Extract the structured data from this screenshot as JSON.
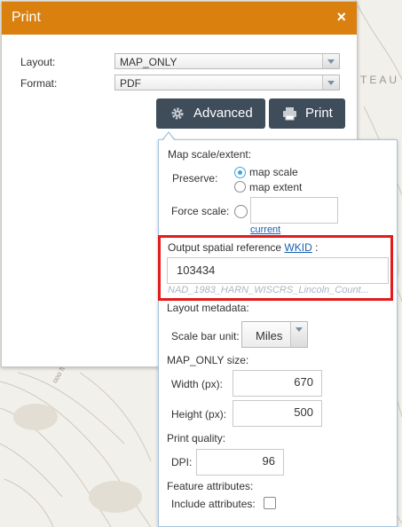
{
  "map": {
    "label_right": "TEAU",
    "label_small": "ooo ft"
  },
  "print_panel": {
    "title": "Print",
    "close_symbol": "×",
    "layout_label": "Layout:",
    "layout_value": "MAP_ONLY",
    "format_label": "Format:",
    "format_value": "PDF",
    "advanced_label": "Advanced",
    "print_label": "Print",
    "icons": [
      "gear-icon",
      "printer-icon",
      "chevron-down-icon",
      "close-icon"
    ]
  },
  "advanced": {
    "scale_section": "Map scale/extent:",
    "preserve_label": "Preserve:",
    "option_map_scale": "map scale",
    "option_map_extent": "map extent",
    "force_scale_label": "Force scale:",
    "force_scale_value": "",
    "current_link": "current",
    "osr_label": "Output spatial reference ",
    "osr_link": "WKID",
    "osr_suffix": " :",
    "osr_value": "103434",
    "osr_name": "NAD_1983_HARN_WISCRS_Lincoln_Count...",
    "layout_metadata": "Layout metadata:",
    "scale_bar_unit_label": "Scale bar unit:",
    "scale_bar_unit_value": "Miles",
    "size_section": "MAP_ONLY size:",
    "width_label": "Width (px):",
    "width_value": "670",
    "height_label": "Height (px):",
    "height_value": "500",
    "quality_section": "Print quality:",
    "dpi_label": "DPI:",
    "dpi_value": "96",
    "feature_attributes": "Feature attributes:",
    "include_attributes_label": "Include attributes:"
  },
  "colors": {
    "header": "#d9800f",
    "button": "#3f4c5a",
    "highlight": "#e31b1b",
    "radio_accent": "#3ea6d8",
    "link": "#1a5fb4"
  }
}
